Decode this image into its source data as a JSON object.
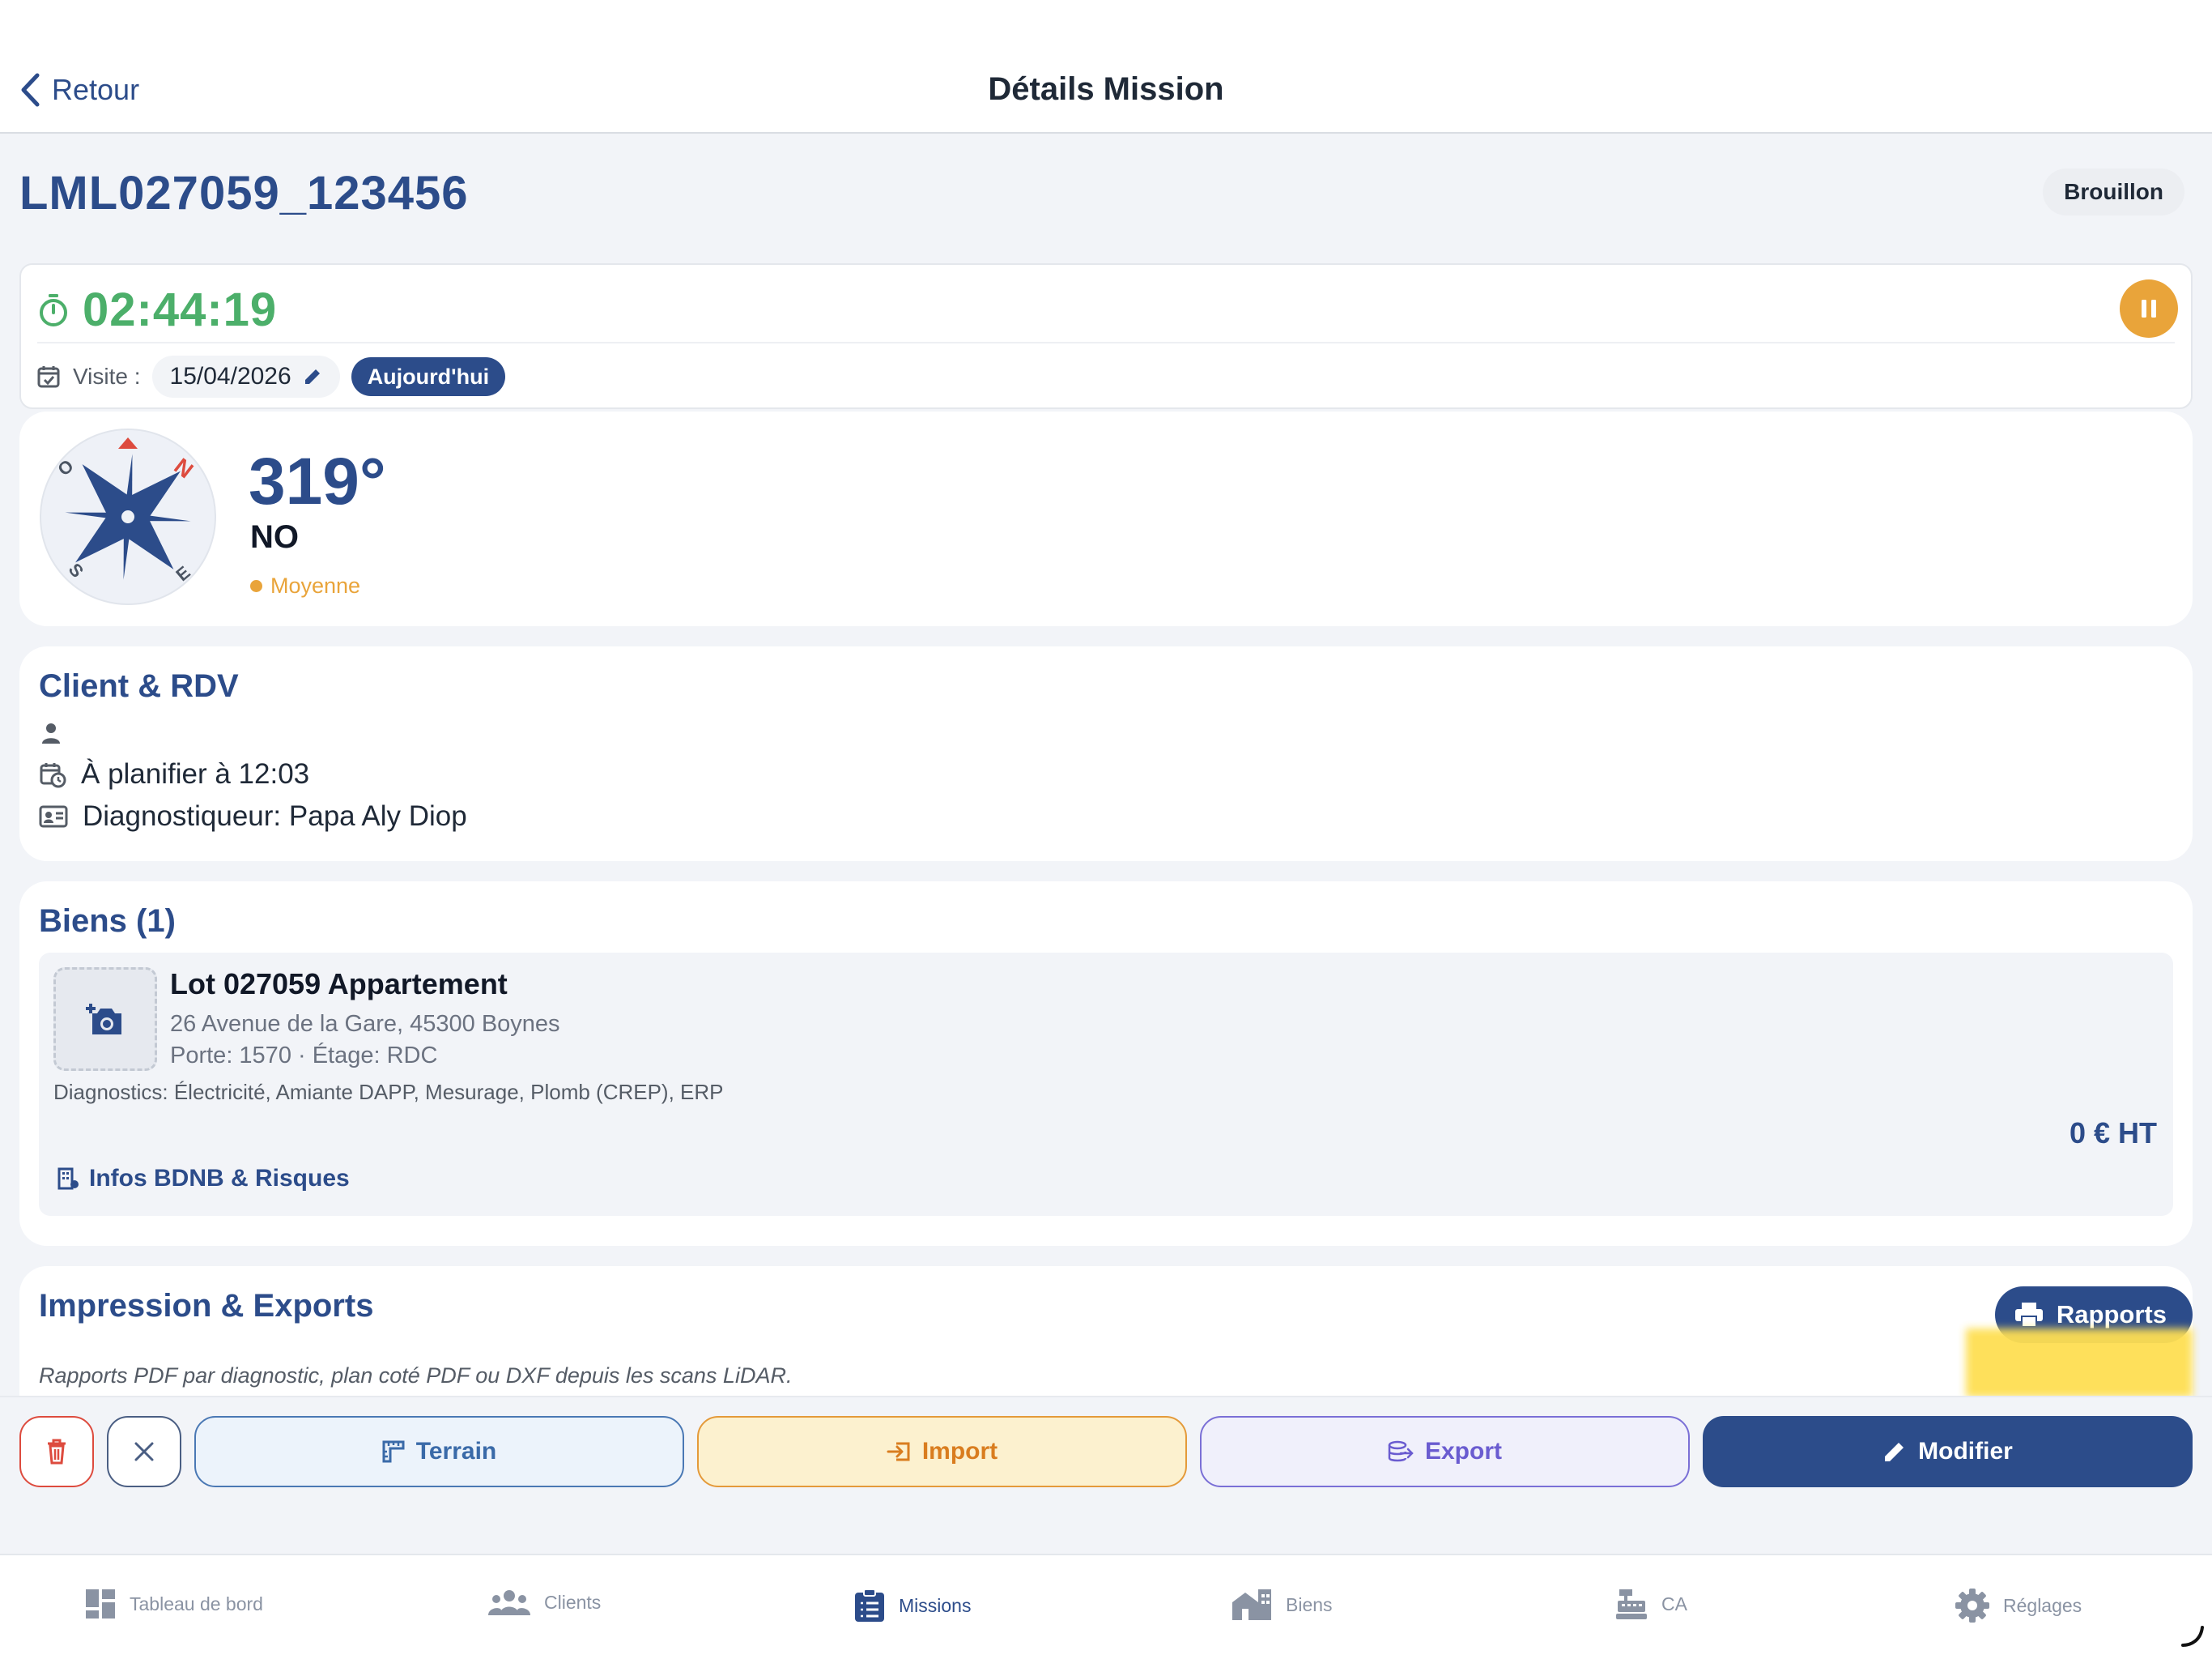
{
  "nav": {
    "back_label": "Retour",
    "title": "Détails Mission"
  },
  "mission": {
    "id": "LML027059_123456",
    "status": "Brouillon"
  },
  "timer": {
    "value": "02:44:19",
    "visit_label": "Visite :",
    "visit_date": "15/04/2026",
    "today_badge": "Aujourd'hui"
  },
  "compass": {
    "degrees": "319°",
    "direction": "NO",
    "accuracy": "Moyenne",
    "labels": {
      "n": "N",
      "o": "O",
      "s": "S",
      "e": "E"
    }
  },
  "client": {
    "title": "Client & RDV",
    "name": "",
    "schedule": "À planifier à 12:03",
    "diagnostician": "Diagnostiqueur: Papa Aly Diop"
  },
  "biens": {
    "title": "Biens (1)",
    "items": [
      {
        "title": "Lot 027059 Appartement",
        "address": "26 Avenue de la Gare, 45300 Boynes",
        "porte_etage": "Porte: 1570 · Étage: RDC",
        "diagnostics": "Diagnostics: Électricité, Amiante DAPP, Mesurage, Plomb (CREP), ERP",
        "price": "0 € HT",
        "bdnb_link": "Infos BDNB & Risques"
      }
    ]
  },
  "impression": {
    "title": "Impression & Exports",
    "rapports_label": "Rapports",
    "description": "Rapports PDF par diagnostic, plan coté PDF ou DXF depuis les scans LiDAR."
  },
  "actions": {
    "terrain": "Terrain",
    "import": "Import",
    "export": "Export",
    "modifier": "Modifier"
  },
  "tabs": [
    {
      "label": "Tableau de bord",
      "icon": "dashboard-icon"
    },
    {
      "label": "Clients",
      "icon": "users-icon"
    },
    {
      "label": "Missions",
      "icon": "clipboard-list-icon",
      "active": true
    },
    {
      "label": "Biens",
      "icon": "buildings-icon"
    },
    {
      "label": "CA",
      "icon": "cash-register-icon"
    },
    {
      "label": "Réglages",
      "icon": "gear-icon"
    }
  ],
  "colors": {
    "primary": "#2c4c8a",
    "timer_green": "#4caf6a",
    "warning_orange": "#e9a43a",
    "danger_red": "#dd4b3e",
    "highlight_yellow": "#fedf53"
  }
}
